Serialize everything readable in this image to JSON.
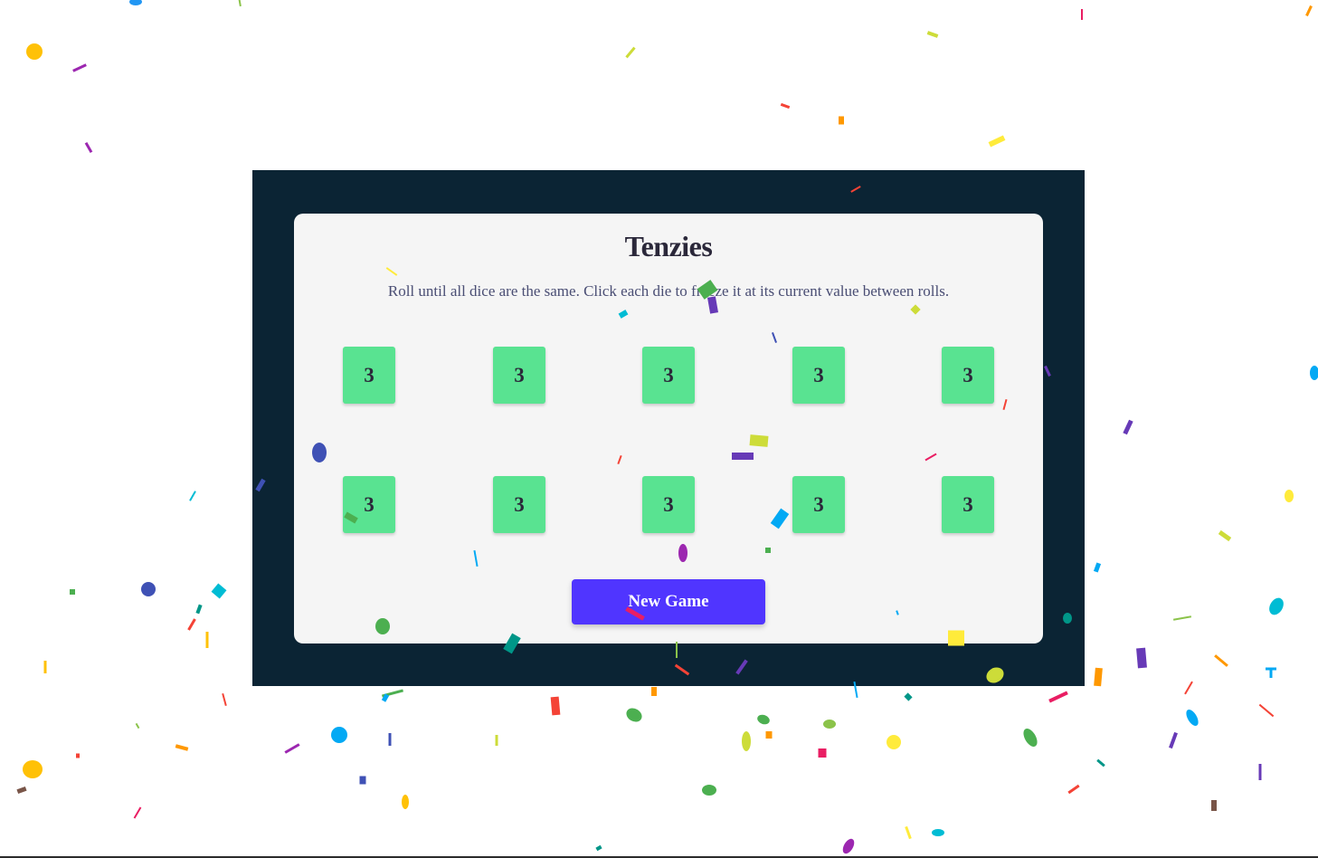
{
  "game": {
    "title": "Tenzies",
    "instructions": "Roll until all dice are the same. Click each die to freeze it at its current value between rolls.",
    "dice": [
      {
        "value": "3",
        "held": false
      },
      {
        "value": "3",
        "held": false
      },
      {
        "value": "3",
        "held": false
      },
      {
        "value": "3",
        "held": false
      },
      {
        "value": "3",
        "held": false
      },
      {
        "value": "3",
        "held": false
      },
      {
        "value": "3",
        "held": false
      },
      {
        "value": "3",
        "held": false
      },
      {
        "value": "3",
        "held": false
      },
      {
        "value": "3",
        "held": false
      }
    ],
    "new_game_label": "New Game"
  },
  "colors": {
    "frame": "#0b2434",
    "card": "#f5f5f5",
    "die": "#59e391",
    "button": "#5035ff"
  },
  "confetti": {
    "colors": [
      "#ffc107",
      "#9c27b0",
      "#4caf50",
      "#2196f3",
      "#f44336",
      "#ff9800",
      "#cddc39",
      "#3f51b5",
      "#00bcd4",
      "#673ab7",
      "#795548",
      "#ffeb3b",
      "#009688",
      "#e91e63",
      "#03a9f4",
      "#8bc34a"
    ]
  }
}
